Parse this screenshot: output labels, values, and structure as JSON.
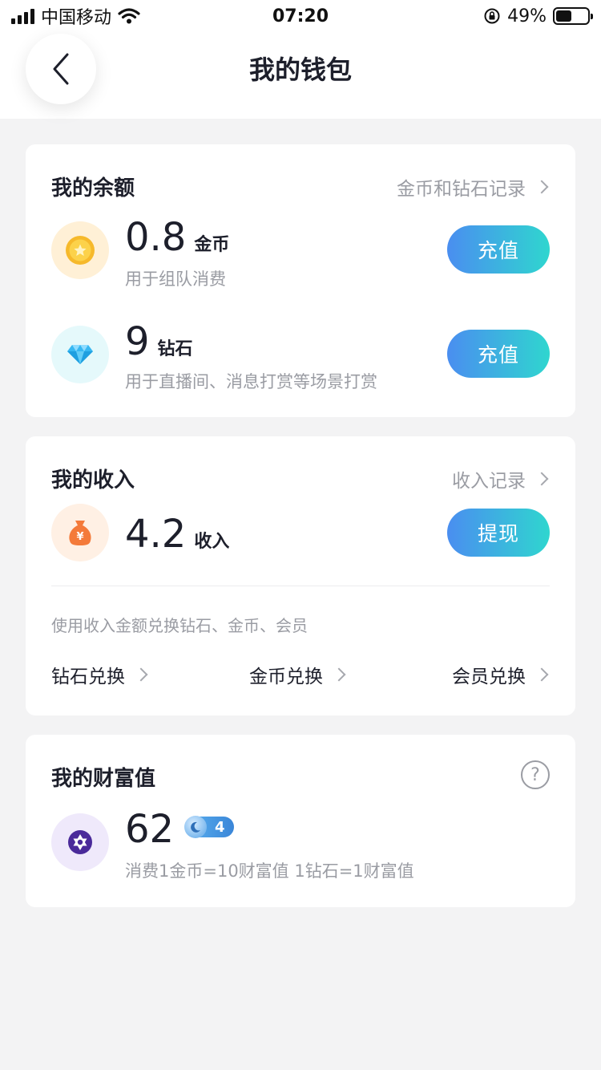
{
  "status_bar": {
    "carrier": "中国移动",
    "time": "07:20",
    "battery": "49%",
    "battery_level": 0.49
  },
  "nav": {
    "title": "我的钱包",
    "back_icon": "chevron-left-icon"
  },
  "balance": {
    "title": "我的余额",
    "record_link": "金币和钻石记录",
    "coins": {
      "value": "0.8",
      "unit": "金币",
      "desc": "用于组队消费",
      "button": "充值",
      "icon": "gold-coin-icon"
    },
    "diamonds": {
      "value": "9",
      "unit": "钻石",
      "desc": "用于直播间、消息打赏等场景打赏",
      "button": "充值",
      "icon": "diamond-icon"
    }
  },
  "income": {
    "title": "我的收入",
    "record_link": "收入记录",
    "value": "4.2",
    "unit": "收入",
    "button": "提现",
    "icon": "money-bag-icon",
    "exchange_note": "使用收入金额兑换钻石、金币、会员",
    "exchange_items": [
      "钻石兑换",
      "金币兑换",
      "会员兑换"
    ]
  },
  "wealth": {
    "title": "我的财富值",
    "value": "62",
    "level": "4",
    "desc": "消费1金币=10财富值 1钻石=1财富值",
    "icon": "star-of-david-icon",
    "help_icon": "?"
  },
  "colors": {
    "button_gradient_start": "#4a8ef0",
    "button_gradient_end": "#2fd6cf",
    "background": "#f3f3f4"
  }
}
